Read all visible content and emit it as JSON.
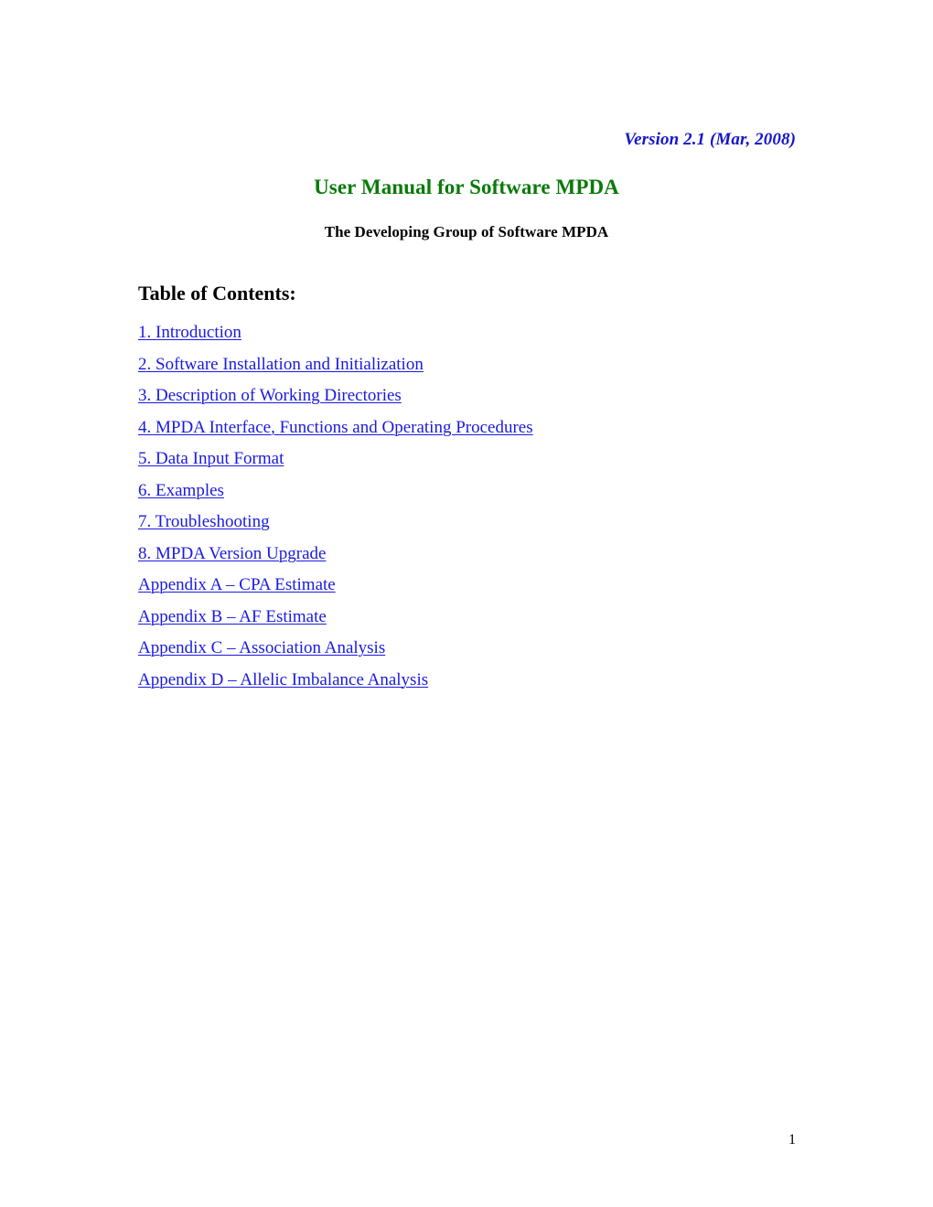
{
  "document": {
    "version_line": "Version 2.1 (Mar, 2008)",
    "title": "User Manual for Software MPDA",
    "subtitle": "The Developing Group of Software MPDA",
    "toc_heading": "Table of Contents:",
    "page_number": "1",
    "colors": {
      "title_green": "#0A7A0A",
      "version_blue": "#1515CD",
      "link_blue": "#1A1AE0",
      "body_black": "#000000",
      "page_background": "#FFFFFF"
    }
  },
  "toc": {
    "items": [
      {
        "label": "1. Introduction"
      },
      {
        "label": "2. Software Installation and Initialization"
      },
      {
        "label": "3. Description of Working Directories"
      },
      {
        "label": "4. MPDA Interface, Functions and Operating Procedures"
      },
      {
        "label": "5. Data Input Format"
      },
      {
        "label": "6. Examples"
      },
      {
        "label": "7. Troubleshooting"
      },
      {
        "label": "8. MPDA Version Upgrade"
      },
      {
        "label": "Appendix A – CPA Estimate"
      },
      {
        "label": "Appendix B – AF Estimate"
      },
      {
        "label": "Appendix C – Association Analysis"
      },
      {
        "label": "Appendix D – Allelic Imbalance Analysis"
      }
    ]
  }
}
